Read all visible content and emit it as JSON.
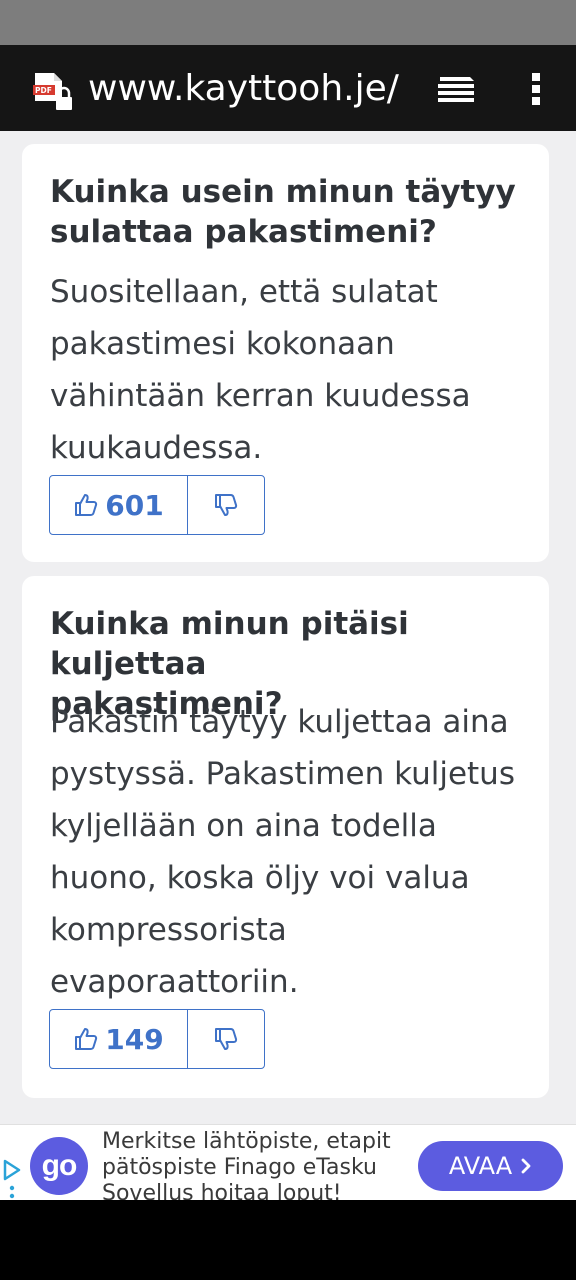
{
  "browser": {
    "url": "www.kayttooh.je/p",
    "pdf_icon_label": "PDF"
  },
  "faq": [
    {
      "question_lines": [
        "Kuinka usein minun täytyy",
        "sulattaa pakastimeni?"
      ],
      "answer_lines": [
        "Suositellaan, että sulatat",
        "pakastimesi kokonaan",
        "vähintään kerran kuudessa",
        "kuukaudessa."
      ],
      "upvotes": "601"
    },
    {
      "question_lines": [
        "Kuinka minun pitäisi kuljettaa",
        "pakastimeni?"
      ],
      "answer_lines": [
        "Pakastin täytyy kuljettaa aina",
        "pystyssä. Pakastimen kuljetus",
        "kyljellään on aina todella",
        "huono, koska öljy voi valua",
        "kompressorista",
        "evaporaattoriin."
      ],
      "upvotes": "149"
    }
  ],
  "ad": {
    "logo_text": "go",
    "lines": [
      "Merkitse lähtöpiste, etapit",
      "pätöspiste Finago eTasku",
      "Sovellus hoitaa loput!"
    ],
    "button_label": "AVAA",
    "accent_color": "#5c5ce0"
  },
  "colors": {
    "vote_blue": "#3f72c8"
  }
}
